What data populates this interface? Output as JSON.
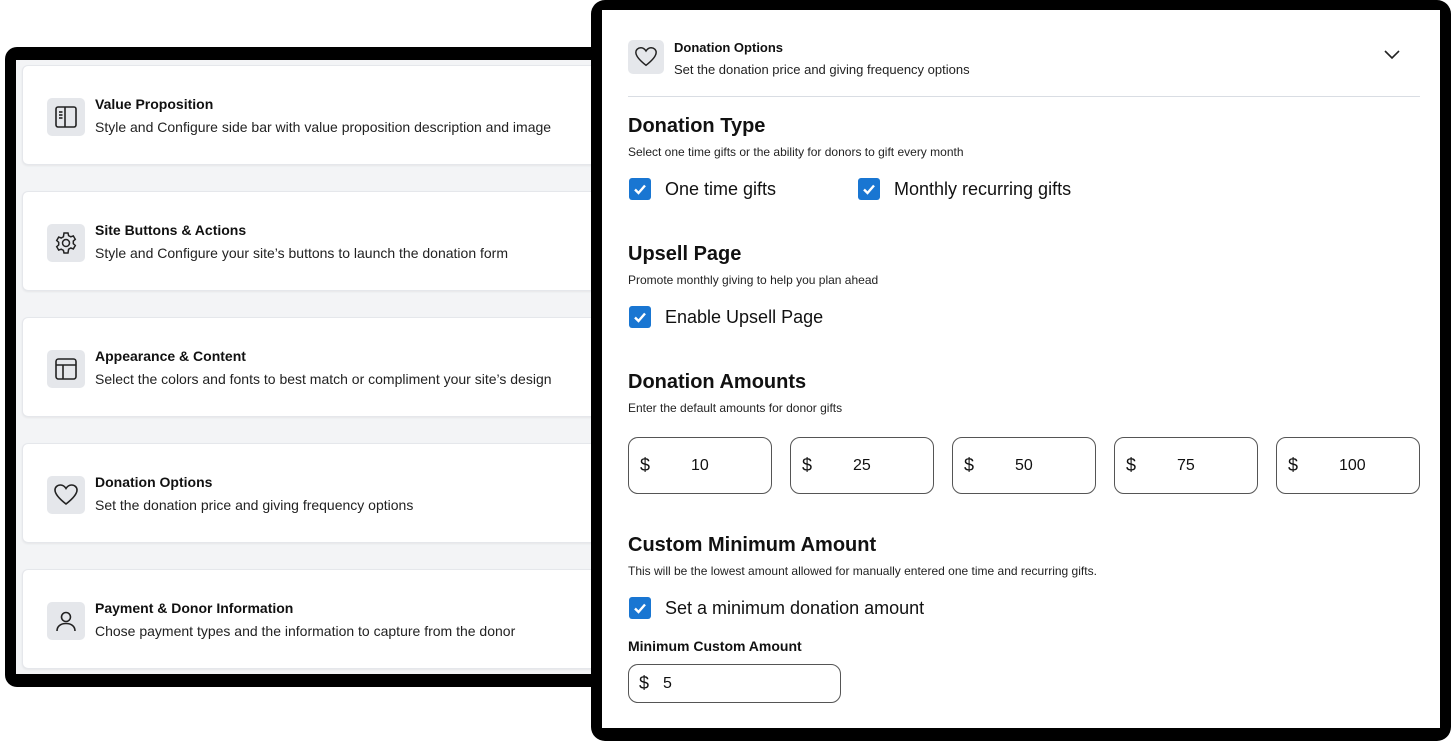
{
  "sidebar": {
    "items": [
      {
        "title": "Value Proposition",
        "desc": "Style and Configure side bar with value proposition description and image",
        "icon": "sidebar-layout-icon"
      },
      {
        "title": "Site Buttons & Actions",
        "desc": "Style and Configure your site’s buttons to launch the donation form",
        "icon": "gear-icon"
      },
      {
        "title": "Appearance & Content",
        "desc": "Select the colors and fonts to best match or compliment your site’s design",
        "icon": "layout-icon"
      },
      {
        "title": "Donation Options",
        "desc": "Set the donation price and giving frequency options",
        "icon": "heart-icon"
      },
      {
        "title": "Payment & Donor Information",
        "desc": "Chose payment types and the information to capture from the donor",
        "icon": "user-icon"
      }
    ]
  },
  "panel": {
    "header": {
      "title": "Donation Options",
      "desc": "Set the donation price and giving frequency options",
      "icon": "heart-icon",
      "toggle_icon": "chevron-down-icon"
    },
    "donation_type": {
      "title": "Donation Type",
      "desc": "Select one time gifts or the ability for donors to gift every month",
      "options": [
        {
          "label": "One time gifts",
          "checked": true
        },
        {
          "label": "Monthly recurring gifts",
          "checked": true
        }
      ]
    },
    "upsell": {
      "title": "Upsell Page",
      "desc": "Promote monthly giving to help you plan ahead",
      "option": {
        "label": "Enable Upsell Page",
        "checked": true
      }
    },
    "amounts": {
      "title": "Donation Amounts",
      "desc": "Enter the default amounts for donor gifts",
      "currency": "$",
      "values": [
        "10",
        "25",
        "50",
        "75",
        "100"
      ]
    },
    "custom_min": {
      "title": "Custom Minimum Amount",
      "desc": "This will be the lowest amount allowed for manually entered one time and recurring gifts.",
      "option": {
        "label": "Set a minimum donation amount",
        "checked": true
      },
      "field_label": "Minimum Custom Amount",
      "currency": "$",
      "value": "5"
    }
  },
  "colors": {
    "checkbox": "#1976d2",
    "icon_bg": "#e5e7eb",
    "frame": "#000000"
  }
}
